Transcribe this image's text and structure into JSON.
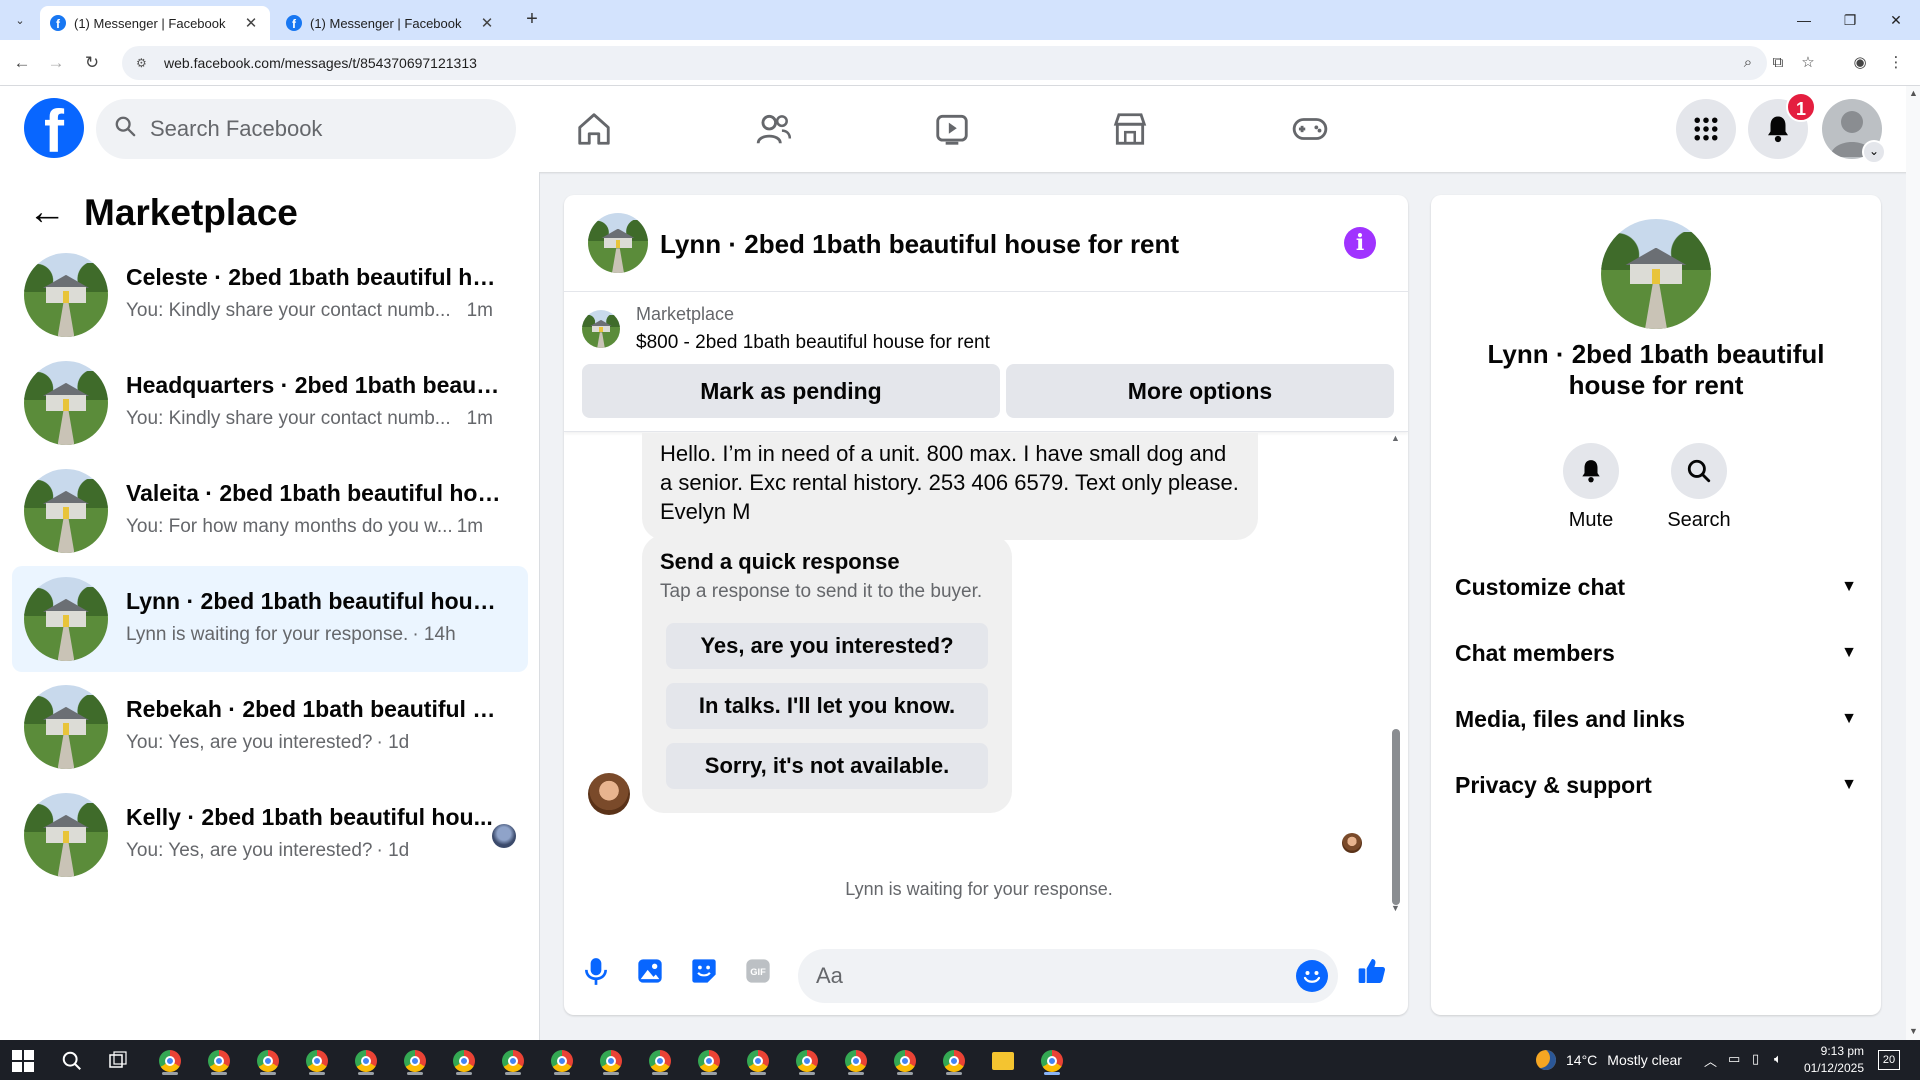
{
  "browser": {
    "tabs": [
      {
        "title": "(1) Messenger | Facebook",
        "active": true
      },
      {
        "title": "(1) Messenger | Facebook",
        "active": false
      }
    ],
    "url": "web.facebook.com/messages/t/854370697121313"
  },
  "header": {
    "search_placeholder": "Search Facebook",
    "notification_count": "1",
    "brand_color": "#0866ff"
  },
  "sidebar": {
    "title": "Marketplace",
    "conversations": [
      {
        "name": "Celeste · 2bed 1bath beautiful hou...",
        "snippet": "You: Kindly share your contact numb...",
        "time": "1m",
        "active": false
      },
      {
        "name": "Headquarters · 2bed 1bath beautif...",
        "snippet": "You: Kindly share your contact numb...",
        "time": "1m",
        "active": false
      },
      {
        "name": "Valeita · 2bed 1bath beautiful hous...",
        "snippet": "You: For how many months do you w...",
        "time": "1m",
        "active": false
      },
      {
        "name": "Lynn · 2bed 1bath beautiful house ...",
        "snippet": "Lynn is waiting for your response.",
        "time": "· 14h",
        "active": true
      },
      {
        "name": "Rebekah · 2bed 1bath beautiful ho...",
        "snippet": "You: Yes, are you interested?",
        "time": "· 1d",
        "active": false
      },
      {
        "name": "Kelly · 2bed 1bath beautiful hou...",
        "snippet": "You: Yes, are you interested?",
        "time": "· 1d",
        "active": false
      }
    ]
  },
  "chat": {
    "title": "Lynn · 2bed 1bath beautiful house for rent",
    "marketplace_label": "Marketplace",
    "listing": "$800 - 2bed 1bath beautiful house for rent",
    "mark_pending": "Mark as pending",
    "more_options": "More options",
    "message": "Hello. I’m in need of a unit. 800 max. I have small dog and a senior. Exc rental history. 253 406 6579. Text only please. Evelyn M",
    "quick_title": "Send a quick response",
    "quick_sub": "Tap a response to send it to the buyer.",
    "quick_responses": [
      "Yes, are you interested?",
      "In talks. I'll let you know.",
      "Sorry, it's not available."
    ],
    "waiting": "Lynn is waiting for your response.",
    "composer_placeholder": "Aa"
  },
  "info": {
    "title": "Lynn · 2bed 1bath beautiful house for rent",
    "mute": "Mute",
    "search": "Search",
    "sections": [
      "Customize chat",
      "Chat members",
      "Media, files and links",
      "Privacy & support"
    ]
  },
  "taskbar": {
    "temperature": "14°C",
    "weather": "Mostly clear",
    "time": "9:13 pm",
    "date": "01/12/2025",
    "notifications": "20"
  }
}
